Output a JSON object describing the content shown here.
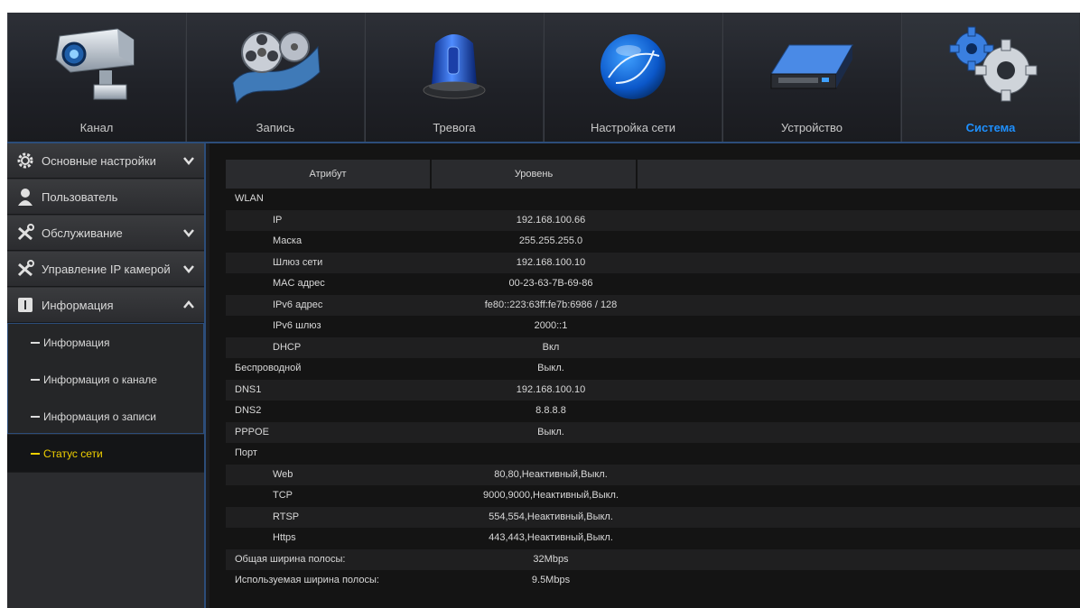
{
  "top_tabs": [
    {
      "label": "Канал",
      "icon": "camera-icon"
    },
    {
      "label": "Запись",
      "icon": "film-reel-icon"
    },
    {
      "label": "Тревога",
      "icon": "alarm-light-icon"
    },
    {
      "label": "Настройка сети",
      "icon": "globe-icon"
    },
    {
      "label": "Устройство",
      "icon": "hard-drive-icon"
    },
    {
      "label": "Система",
      "icon": "gears-icon",
      "active": true
    }
  ],
  "sidebar": {
    "items": [
      {
        "label": "Основные настройки",
        "icon": "gear-icon",
        "chevron": "down"
      },
      {
        "label": "Пользователь",
        "icon": "user-icon"
      },
      {
        "label": "Обслуживание",
        "icon": "tools-icon",
        "chevron": "down"
      },
      {
        "label": "Управление IP камерой",
        "icon": "tools-icon",
        "chevron": "down"
      },
      {
        "label": "Информация",
        "icon": "info-book-icon",
        "chevron": "up"
      }
    ],
    "subitems": [
      {
        "label": "Информация"
      },
      {
        "label": "Информация о канале"
      },
      {
        "label": "Информация о записи"
      },
      {
        "label": "Статус сети",
        "active": true
      }
    ]
  },
  "table": {
    "col_attr": "Атрибут",
    "col_level": "Уровень",
    "rows": [
      {
        "k": "WLAN",
        "v": ""
      },
      {
        "k": "IP",
        "v": "192.168.100.66",
        "indent": true
      },
      {
        "k": "Маска",
        "v": "255.255.255.0",
        "indent": true
      },
      {
        "k": "Шлюз сети",
        "v": "192.168.100.10",
        "indent": true
      },
      {
        "k": "MAC адрес",
        "v": "00-23-63-7B-69-86",
        "indent": true
      },
      {
        "k": "IPv6 адрес",
        "v": "fe80::223:63ff:fe7b:6986 / 128",
        "indent": true
      },
      {
        "k": "IPv6 шлюз",
        "v": "2000::1",
        "indent": true
      },
      {
        "k": "DHCP",
        "v": "Вкл",
        "indent": true
      },
      {
        "k": "Беспроводной",
        "v": "Выкл."
      },
      {
        "k": "DNS1",
        "v": "192.168.100.10"
      },
      {
        "k": "DNS2",
        "v": "8.8.8.8"
      },
      {
        "k": "PPPOE",
        "v": "Выкл."
      },
      {
        "k": "Порт",
        "v": ""
      },
      {
        "k": "Web",
        "v": "80,80,Неактивный,Выкл.",
        "indent": true
      },
      {
        "k": "TCP",
        "v": "9000,9000,Неактивный,Выкл.",
        "indent": true
      },
      {
        "k": "RTSP",
        "v": "554,554,Неактивный,Выкл.",
        "indent": true
      },
      {
        "k": "Https",
        "v": "443,443,Неактивный,Выкл.",
        "indent": true
      },
      {
        "k": "Общая ширина полосы:",
        "v": "32Mbps"
      },
      {
        "k": "Используемая ширина полосы:",
        "v": "9.5Mbps"
      }
    ]
  },
  "colors": {
    "accent": "#1e90ff",
    "active_sub": "#f0d000",
    "frame": "#2c4d7a"
  }
}
